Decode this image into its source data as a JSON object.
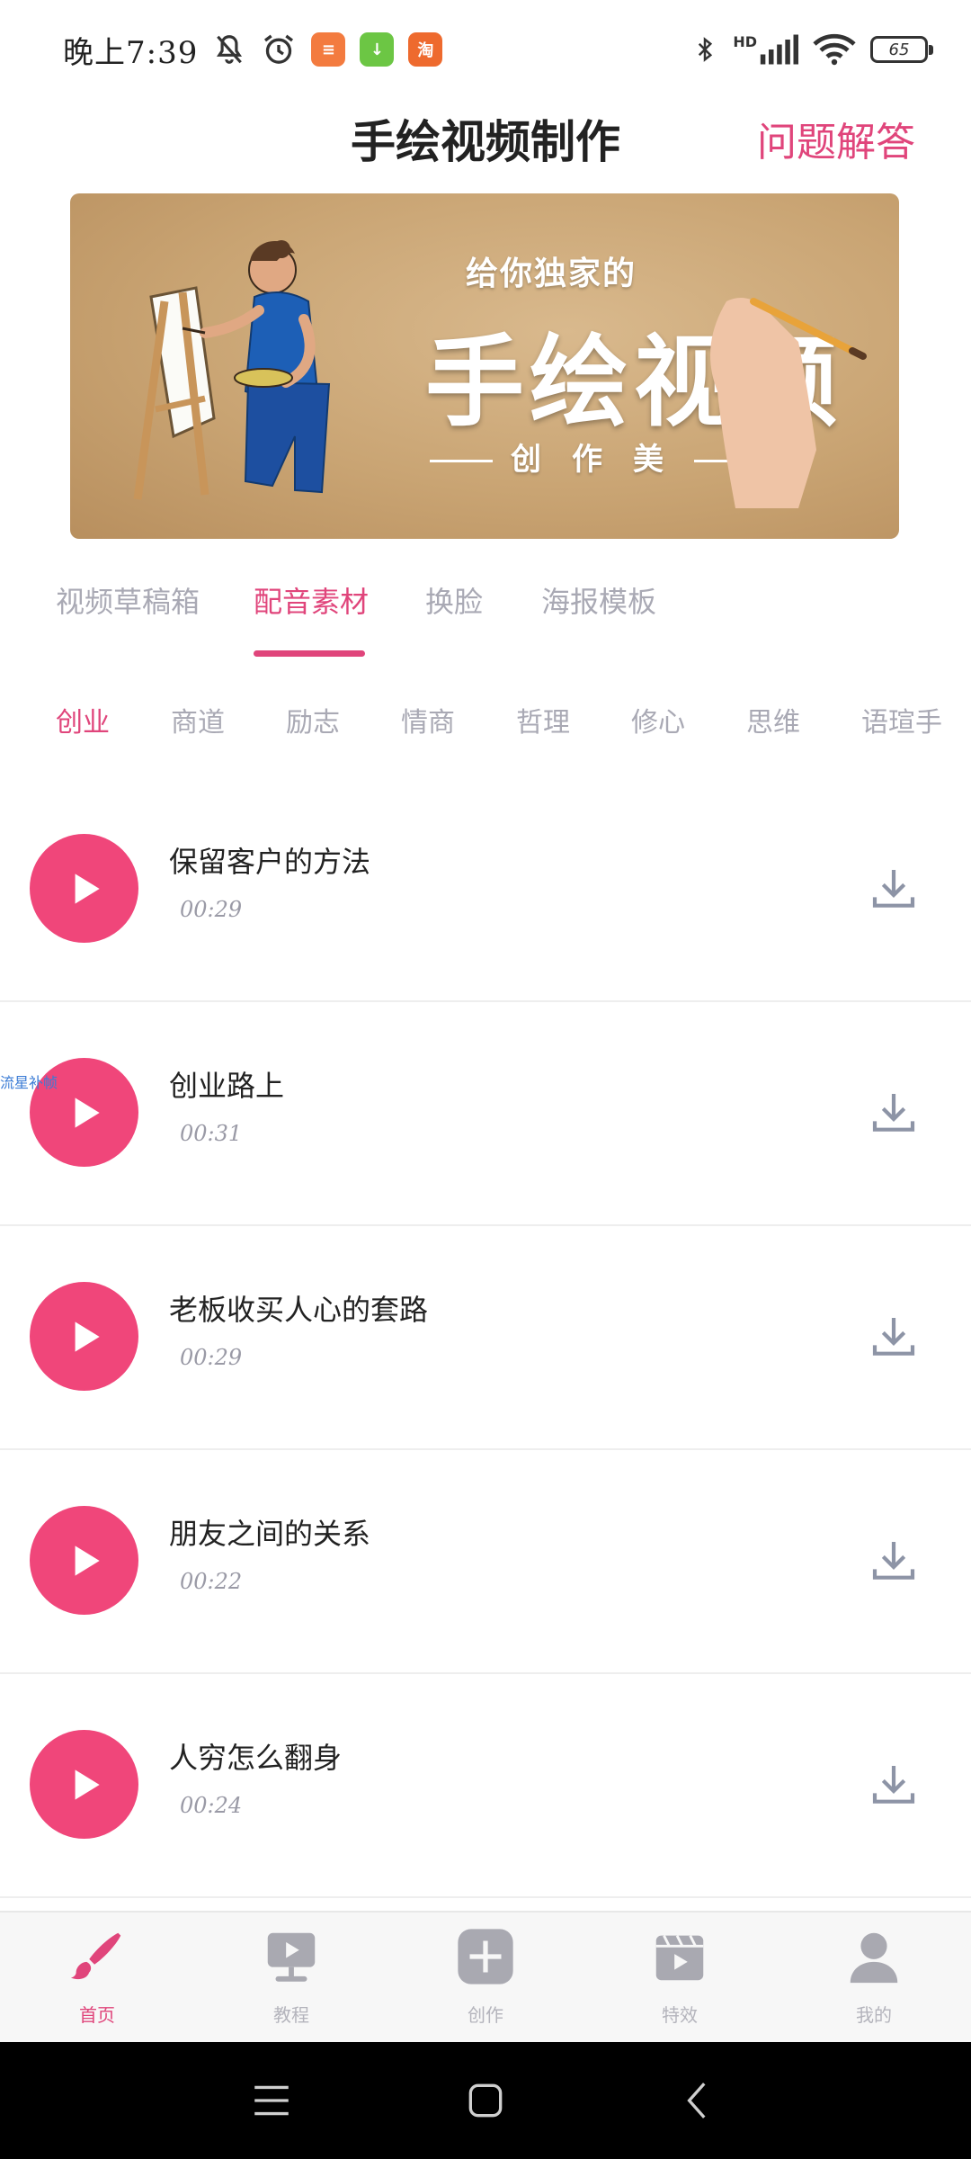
{
  "status_bar": {
    "time": "晚上7:39",
    "battery": "65",
    "signal_label": "HD",
    "badges": [
      {
        "name": "mi-badge",
        "color": "#f37b3f",
        "text": "≡"
      },
      {
        "name": "download-badge",
        "color": "#6cc644",
        "text": "↓"
      },
      {
        "name": "taobao-badge",
        "color": "#ee6a2e",
        "text": "淘"
      }
    ]
  },
  "header": {
    "title": "手绘视频制作",
    "faq": "问题解答"
  },
  "banner": {
    "subtitle": "给你独家的",
    "title": "手绘视频",
    "tagline": "创作美"
  },
  "tabs": [
    {
      "label": "视频草稿箱",
      "active": false
    },
    {
      "label": "配音素材",
      "active": true
    },
    {
      "label": "换脸",
      "active": false
    },
    {
      "label": "海报模板",
      "active": false
    }
  ],
  "categories": [
    {
      "label": "创业",
      "active": true
    },
    {
      "label": "商道",
      "active": false
    },
    {
      "label": "励志",
      "active": false
    },
    {
      "label": "情商",
      "active": false
    },
    {
      "label": "哲理",
      "active": false
    },
    {
      "label": "修心",
      "active": false
    },
    {
      "label": "思维",
      "active": false
    },
    {
      "label": "语瑄手",
      "active": false
    }
  ],
  "audio_items": [
    {
      "title": "保留客户的方法",
      "duration": "00:29"
    },
    {
      "title": "创业路上",
      "duration": "00:31"
    },
    {
      "title": "老板收买人心的套路",
      "duration": "00:29"
    },
    {
      "title": "朋友之间的关系",
      "duration": "00:22"
    },
    {
      "title": "人穷怎么翻身",
      "duration": "00:24"
    }
  ],
  "floating_label": "流星补帧",
  "bottom_nav": [
    {
      "label": "首页",
      "icon": "brush-icon",
      "active": true
    },
    {
      "label": "教程",
      "icon": "tutorial-screen-icon",
      "active": false
    },
    {
      "label": "创作",
      "icon": "create-plus-icon",
      "active": false
    },
    {
      "label": "特效",
      "icon": "effects-clapper-icon",
      "active": false
    },
    {
      "label": "我的",
      "icon": "profile-person-icon",
      "active": false
    }
  ],
  "colors": {
    "accent": "#e0457b",
    "play_button": "#f0467a",
    "inactive_text": "#a9a9b4",
    "download_icon": "#8d94a6"
  }
}
